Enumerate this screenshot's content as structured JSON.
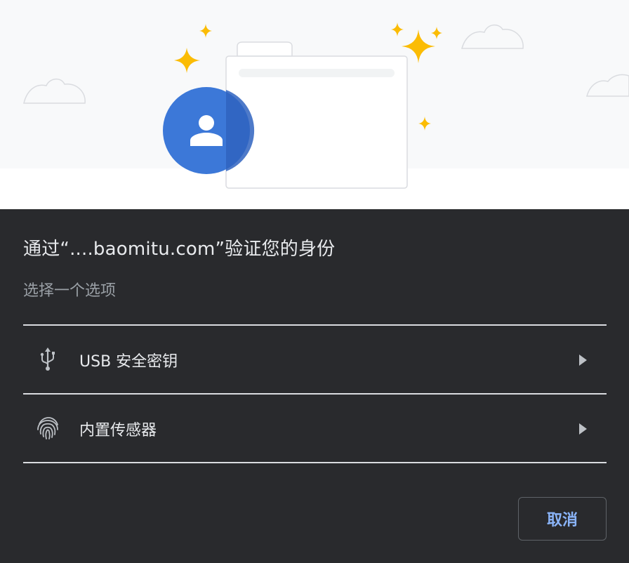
{
  "dialog": {
    "title": "通过“....baomitu.com”验证您的身份",
    "subtitle": "选择一个选项",
    "options": [
      {
        "icon": "usb-icon",
        "label": "USB 安全密钥"
      },
      {
        "icon": "fingerprint-icon",
        "label": "内置传感器"
      }
    ],
    "cancel_label": "取消"
  },
  "colors": {
    "background": "#292a2d",
    "illustration_bg": "#f8f9fa",
    "avatar_blue": "#3c78d8",
    "sparkle_yellow": "#fbbc04",
    "text_primary": "#e8eaed",
    "text_secondary": "#9aa0a6",
    "accent": "#8ab4f8",
    "divider": "#dadce0"
  }
}
